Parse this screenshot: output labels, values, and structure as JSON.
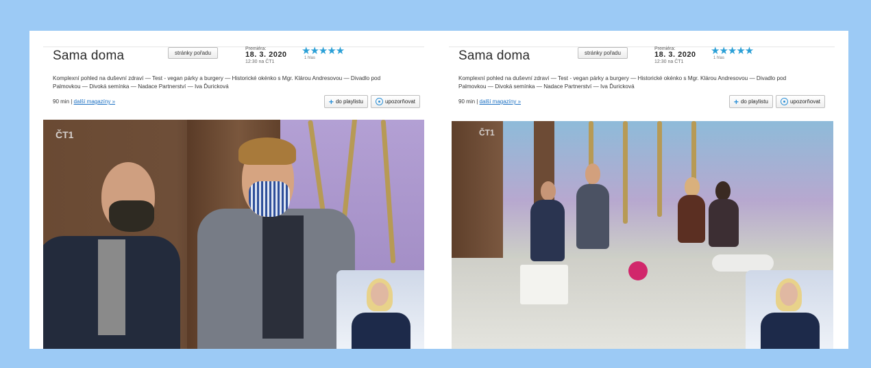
{
  "panels": [
    {
      "title": "Sama doma",
      "pages_button": "stránky pořadu",
      "premiere_label": "Premiéra:",
      "premiere_date": "18. 3. 2020",
      "premiere_time": "12:30 na ČT1",
      "stars": "★★★★★",
      "rating_count": "1 hlas",
      "description": "Komplexní pohled na duševní zdraví — Test - vegan párky a burgery — Historické okénko s Mgr. Klárou Andresovou — Divadlo pod Palmovkou — Divoká semínka — Nadace Partnerství — Iva Ďuricková",
      "duration": "90 min",
      "more_link": "další magazíny »",
      "playlist_button": "do playlistu",
      "notify_button": "upozorňovat",
      "channel_logo": "ČT1"
    },
    {
      "title": "Sama doma",
      "pages_button": "stránky pořadu",
      "premiere_label": "Premiéra:",
      "premiere_date": "18. 3. 2020",
      "premiere_time": "12:30 na ČT1",
      "stars": "★★★★★",
      "rating_count": "1 hlas",
      "description": "Komplexní pohled na duševní zdraví — Test - vegan párky a burgery — Historické okénko s Mgr. Klárou Andresovou — Divadlo pod Palmovkou — Divoká semínka — Nadace Partnerství — Iva Ďuricková",
      "duration": "90 min",
      "more_link": "další magazíny »",
      "playlist_button": "do playlistu",
      "notify_button": "upozorňovat",
      "channel_logo": "ČT1"
    }
  ],
  "colors": {
    "background": "#9ccaf5",
    "stars": "#2a9fd6",
    "link": "#1a6fc2"
  }
}
